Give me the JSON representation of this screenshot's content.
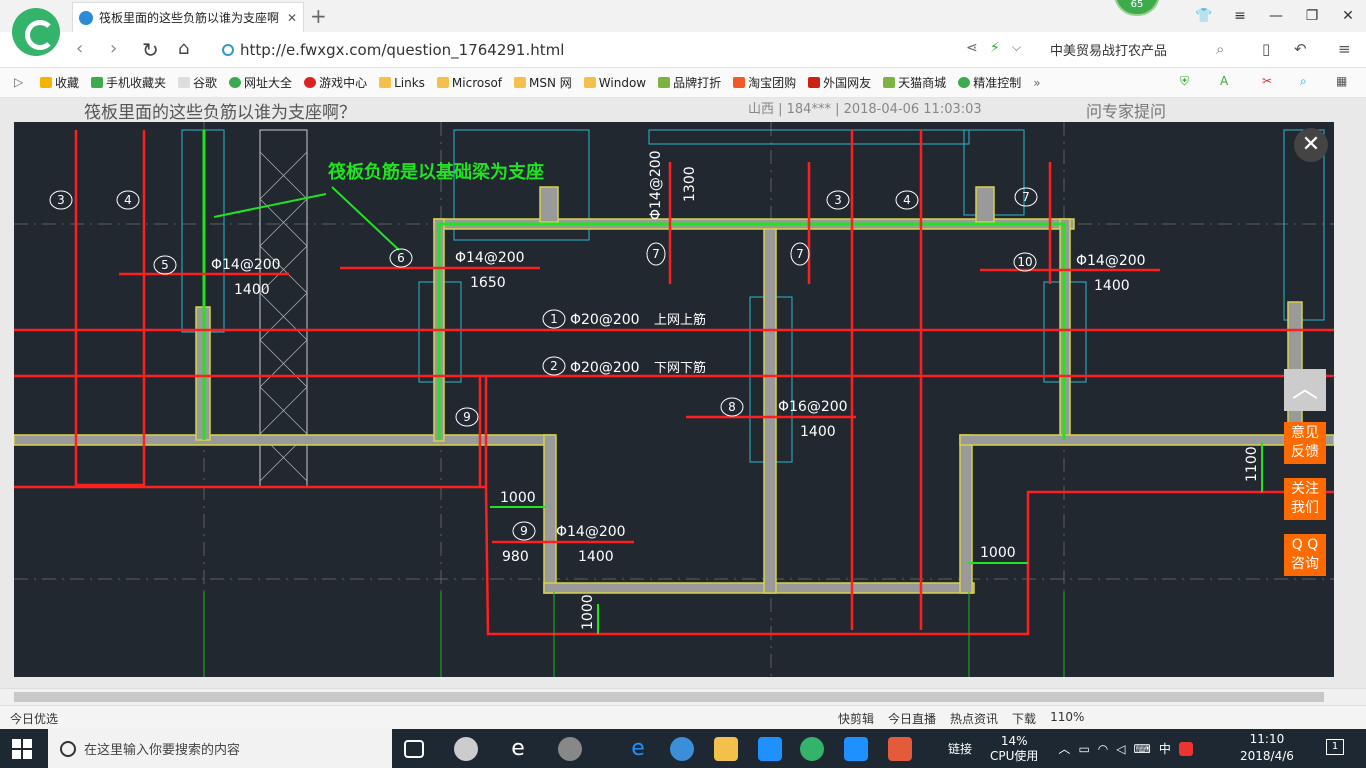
{
  "browser": {
    "tab_title": "筏板里面的这些负筋以谁为支座啊",
    "badge": "65",
    "url": "http://e.fwxgx.com/question_1764291.html",
    "side_search": "中美贸易战打农产品"
  },
  "bookmarks": [
    {
      "label": "收藏",
      "color": "#f5b400"
    },
    {
      "label": "手机收藏夹",
      "color": "#3daa4e"
    },
    {
      "label": "谷歌",
      "color": "#ddd"
    },
    {
      "label": "网址大全",
      "color": "#3daa4e"
    },
    {
      "label": "游戏中心",
      "color": "#d22"
    },
    {
      "label": "Links",
      "color": "#f3c04b"
    },
    {
      "label": "Microsof",
      "color": "#f3c04b"
    },
    {
      "label": "MSN 网",
      "color": "#f3c04b"
    },
    {
      "label": "Window",
      "color": "#f3c04b"
    },
    {
      "label": "品牌打折",
      "color": "#7cb342"
    },
    {
      "label": "淘宝团购",
      "color": "#f05a28"
    },
    {
      "label": "外国网友",
      "color": "#c21"
    },
    {
      "label": "天猫商城",
      "color": "#7cb342"
    },
    {
      "label": "精准控制",
      "color": "#3daa4e"
    }
  ],
  "page": {
    "title": "筏板里面的这些负筋以谁为支座啊？",
    "meta": "山西 | 184*** | 2018-04-06 11:03:03",
    "ask": "问专家提问"
  },
  "drawing": {
    "annotation": "筏板负筋是以基础梁为支座",
    "labels": {
      "n3a": "3",
      "n4a": "4",
      "n5": "5",
      "n6": "6",
      "n7a": "7",
      "n7b": "7",
      "n7c": "7",
      "n3b": "3",
      "n4b": "4",
      "n10": "10",
      "n9a": "9",
      "n1": "1",
      "n2": "2",
      "n8": "8",
      "n9b": "9",
      "r5": "Φ14@200",
      "r5l": "1400",
      "r6": "Φ14@200",
      "r6l": "1650",
      "r7v": "Φ14@200",
      "r7vl": "1300",
      "r10": "Φ14@200",
      "r10l": "1400",
      "r1": "Φ20@200",
      "r1t": "上网上筋",
      "r2": "Φ20@200",
      "r2t": "下网下筋",
      "r8": "Φ16@200",
      "r8l": "1400",
      "r9": "Φ14@200",
      "r9l": "1400",
      "r9a": "980",
      "d1000a": "1000",
      "d1000b": "1000",
      "d1000c": "1000",
      "d1100": "1100"
    }
  },
  "float": {
    "top": "︿",
    "feedback": "意见\n反馈",
    "follow": "关注\n我们",
    "qq": "Q Q\n咨询"
  },
  "status": {
    "left": "今日优选",
    "items": [
      "快剪辑",
      "今日直播",
      "热点资讯",
      "下载",
      "110%"
    ]
  },
  "taskbar": {
    "search_placeholder": "在这里输入你要搜索的内容",
    "tray_link": "链接",
    "cpu_pct": "14%",
    "cpu_label": "CPU使用",
    "ime": "中",
    "time": "11:10",
    "date": "2018/4/6",
    "notif": "1"
  }
}
